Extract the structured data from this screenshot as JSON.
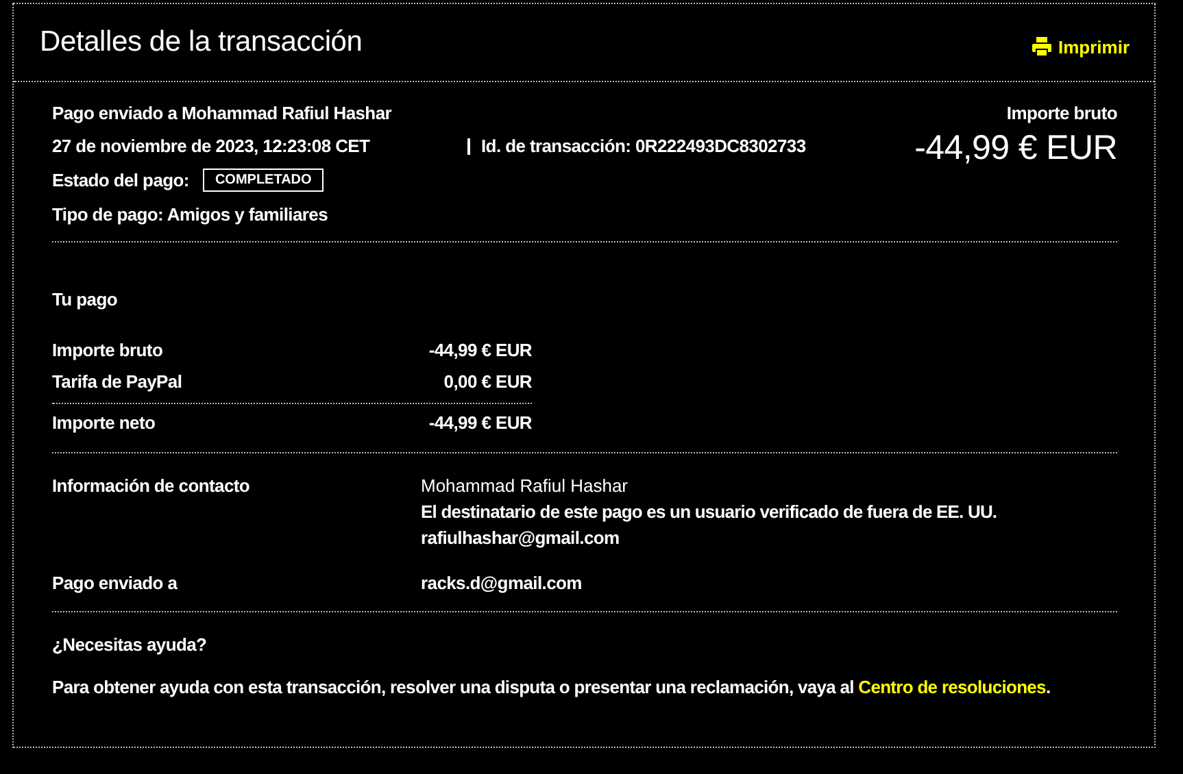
{
  "header": {
    "title": "Detalles de la transacción",
    "print_label": "Imprimir"
  },
  "summary": {
    "sent_to": "Pago enviado a Mohammad Rafiul Hashar",
    "date": "27 de noviembre de 2023, 12:23:08 CET",
    "transaction_id": "Id. de transacción: 0R222493DC8302733",
    "status_label": "Estado del pago:",
    "status": "COMPLETADO",
    "payment_type": "Tipo de pago: Amigos y familiares",
    "amount_label": "Importe bruto",
    "amount": "-44,99 € EUR"
  },
  "payment": {
    "title": "Tu pago",
    "rows": [
      {
        "label": "Importe bruto",
        "value": "-44,99 € EUR",
        "kind": "line"
      },
      {
        "label": "Tarifa de PayPal",
        "value": "0,00 € EUR",
        "kind": "line"
      },
      {
        "label": "Importe neto",
        "value": "-44,99 € EUR",
        "kind": "total"
      }
    ]
  },
  "contact": {
    "label": "Información de contacto",
    "name": "Mohammad Rafiul Hashar",
    "note": "El destinatario de este pago es un usuario **verificado de fuera de EE. UU.**",
    "email": "rafiulhashar@gmail.com"
  },
  "sent_to": {
    "label": "Pago enviado a",
    "value": "racks.d@gmail.com"
  },
  "help": {
    "title": "¿Necesitas ayuda?",
    "text_before": "Para obtener ayuda con esta transacción, resolver una disputa o presentar una reclamación, vaya al ",
    "link": "Centro de resoluciones",
    "text_after": "."
  }
}
